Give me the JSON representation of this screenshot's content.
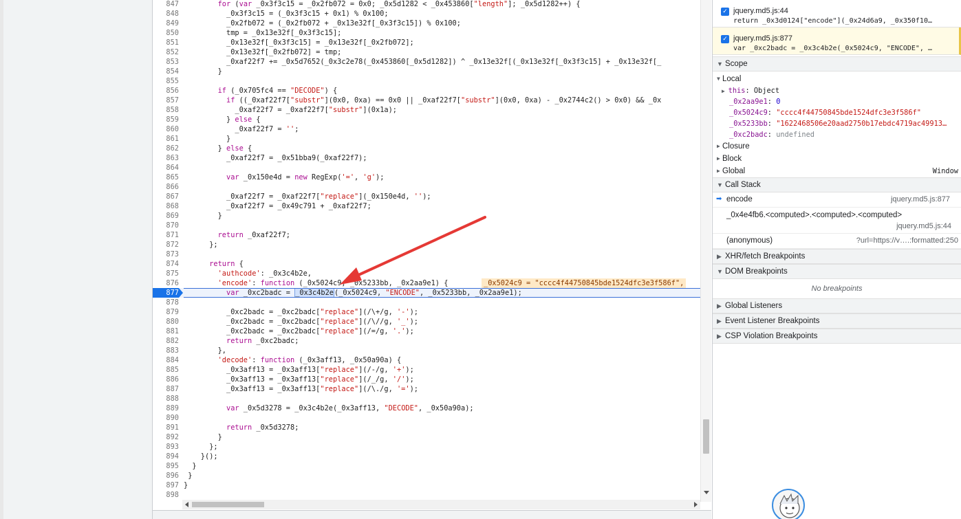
{
  "editor": {
    "lines": [
      {
        "n": "847",
        "code": "        for (var _0x3f3c15 = _0x2fb072 = 0x0; _0x5d1282 < _0x453860[\"length\"]; _0x5d1282++) {"
      },
      {
        "n": "848",
        "code": "          _0x3f3c15 = (_0x3f3c15 + 0x1) % 0x100;"
      },
      {
        "n": "849",
        "code": "          _0x2fb072 = (_0x2fb072 + _0x13e32f[_0x3f3c15]) % 0x100;"
      },
      {
        "n": "850",
        "code": "          tmp = _0x13e32f[_0x3f3c15];"
      },
      {
        "n": "851",
        "code": "          _0x13e32f[_0x3f3c15] = _0x13e32f[_0x2fb072];"
      },
      {
        "n": "852",
        "code": "          _0x13e32f[_0x2fb072] = tmp;"
      },
      {
        "n": "853",
        "code": "          _0xaf22f7 += _0x5d7652(_0x3c2e78(_0x453860[_0x5d1282]) ^ _0x13e32f[(_0x13e32f[_0x3f3c15] + _0x13e32f[_"
      },
      {
        "n": "854",
        "code": "        }"
      },
      {
        "n": "855",
        "code": ""
      },
      {
        "n": "856",
        "code": "        if (_0x705fc4 == \"DECODE\") {"
      },
      {
        "n": "857",
        "code": "          if ((_0xaf22f7[\"substr\"](0x0, 0xa) == 0x0 || _0xaf22f7[\"substr\"](0x0, 0xa) - _0x2744c2() > 0x0) && _0x"
      },
      {
        "n": "858",
        "code": "            _0xaf22f7 = _0xaf22f7[\"substr\"](0x1a);"
      },
      {
        "n": "859",
        "code": "          } else {"
      },
      {
        "n": "860",
        "code": "            _0xaf22f7 = '';"
      },
      {
        "n": "861",
        "code": "          }"
      },
      {
        "n": "862",
        "code": "        } else {"
      },
      {
        "n": "863",
        "code": "          _0xaf22f7 = _0x51bba9(_0xaf22f7);"
      },
      {
        "n": "864",
        "code": ""
      },
      {
        "n": "865",
        "code": "          var _0x150e4d = new RegExp('=', 'g');"
      },
      {
        "n": "866",
        "code": ""
      },
      {
        "n": "867",
        "code": "          _0xaf22f7 = _0xaf22f7[\"replace\"](_0x150e4d, '');"
      },
      {
        "n": "868",
        "code": "          _0xaf22f7 = _0x49c791 + _0xaf22f7;"
      },
      {
        "n": "869",
        "code": "        }"
      },
      {
        "n": "870",
        "code": ""
      },
      {
        "n": "871",
        "code": "        return _0xaf22f7;"
      },
      {
        "n": "872",
        "code": "      };"
      },
      {
        "n": "873",
        "code": ""
      },
      {
        "n": "874",
        "code": "      return {"
      },
      {
        "n": "875",
        "code": "        'authcode': _0x3c4b2e,"
      },
      {
        "n": "876",
        "code": "        'encode': function (_0x5024c9, _0x5233bb, _0x2aa9e1) {",
        "inline": "_0x5024c9 = \"cccc4f44750845bde1524dfc3e3f586f\","
      },
      {
        "n": "877",
        "pre": "          var _0xc2badc = ",
        "token": "_0x3c4b2e",
        "post": "(_0x5024c9, \"ENCODE\", _0x5233bb, _0x2aa9e1);"
      },
      {
        "n": "878",
        "code": ""
      },
      {
        "n": "879",
        "code": "          _0xc2badc = _0xc2badc[\"replace\"](/\\+/g, '-');"
      },
      {
        "n": "880",
        "code": "          _0xc2badc = _0xc2badc[\"replace\"](/\\//g, '_');"
      },
      {
        "n": "881",
        "code": "          _0xc2badc = _0xc2badc[\"replace\"](/=/g, '.');"
      },
      {
        "n": "882",
        "code": "          return _0xc2badc;"
      },
      {
        "n": "883",
        "code": "        },"
      },
      {
        "n": "884",
        "code": "        'decode': function (_0x3aff13, _0x50a90a) {"
      },
      {
        "n": "885",
        "code": "          _0x3aff13 = _0x3aff13[\"replace\"](/-/g, '+');"
      },
      {
        "n": "886",
        "code": "          _0x3aff13 = _0x3aff13[\"replace\"](/_/g, '/');"
      },
      {
        "n": "887",
        "code": "          _0x3aff13 = _0x3aff13[\"replace\"](/\\./g, '=');"
      },
      {
        "n": "888",
        "code": ""
      },
      {
        "n": "889",
        "code": "          var _0x5d3278 = _0x3c4b2e(_0x3aff13, \"DECODE\", _0x50a90a);"
      },
      {
        "n": "890",
        "code": ""
      },
      {
        "n": "891",
        "code": "          return _0x5d3278;"
      },
      {
        "n": "892",
        "code": "        }"
      },
      {
        "n": "893",
        "code": "      };"
      },
      {
        "n": "894",
        "code": "    }();"
      },
      {
        "n": "895",
        "code": "  }"
      },
      {
        "n": "896",
        "code": " }"
      },
      {
        "n": "897",
        "code": "}"
      },
      {
        "n": "898",
        "code": ""
      }
    ],
    "current_line": "877"
  },
  "breakpoints": [
    {
      "label": "jquery.md5.js:44",
      "code": "return _0x3d0124[\"encode\"](_0x24d6a9, _0x350f10…",
      "checked": true,
      "active": false
    },
    {
      "label": "jquery.md5.js:877",
      "code": "var _0xc2badc = _0x3c4b2e(_0x5024c9, \"ENCODE\", …",
      "checked": true,
      "active": true
    }
  ],
  "scope": {
    "title": "Scope",
    "local_label": "Local",
    "this_label": "this",
    "this_value": "Object",
    "vars": [
      {
        "name": "_0x2aa9e1",
        "value": "0",
        "kind": "num"
      },
      {
        "name": "_0x5024c9",
        "value": "\"cccc4f44750845bde1524dfc3e3f586f\"",
        "kind": "str"
      },
      {
        "name": "_0x5233bb",
        "value": "\"1622468506e20aad2750b17ebdc4719ac49913…",
        "kind": "str"
      },
      {
        "name": "_0xc2badc",
        "value": "undefined",
        "kind": "undef"
      }
    ],
    "closure_label": "Closure",
    "block_label": "Block",
    "global_label": "Global",
    "global_value": "Window"
  },
  "call_stack": {
    "title": "Call Stack",
    "frames": [
      {
        "name": "encode",
        "loc": "jquery.md5.js:877"
      },
      {
        "name": "_0x4e4fb6.<computed>.<computed>.<computed>",
        "loc": "jquery.md5.js:44"
      },
      {
        "name": "(anonymous)",
        "loc": "?url=https://v….:formatted:250"
      }
    ]
  },
  "panels": {
    "xhr": "XHR/fetch Breakpoints",
    "dom": "DOM Breakpoints",
    "no_breakpoints": "No breakpoints",
    "global_listeners": "Global Listeners",
    "event_listeners": "Event Listener Breakpoints",
    "csp": "CSP Violation Breakpoints"
  },
  "colors": {
    "accent": "#1a73e8",
    "annotation_arrow": "#e53935",
    "inline_value_bg": "#ffe9c6"
  }
}
